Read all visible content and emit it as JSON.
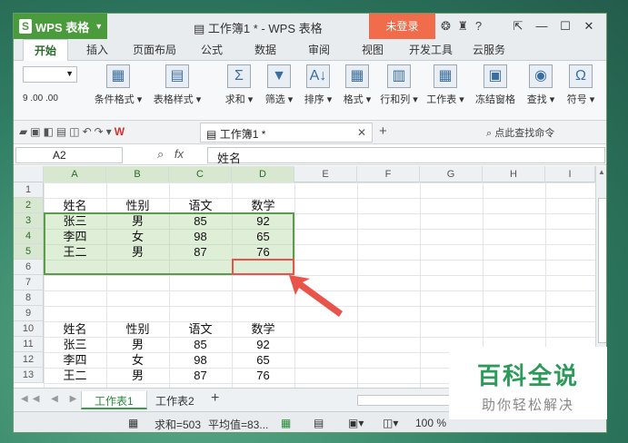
{
  "app": {
    "name": "WPS 表格",
    "logo_letter": "S",
    "title": "工作簿1 * - WPS 表格",
    "login_label": "未登录",
    "accent": "#4a9b3b"
  },
  "menu_tabs": [
    "开始",
    "插入",
    "页面布局",
    "公式",
    "数据",
    "审阅",
    "视图",
    "开发工具",
    "云服务"
  ],
  "ribbon": {
    "buttons": [
      {
        "label": "条件格式 ▾",
        "icon": "conditional-format-icon",
        "glyph": "▦"
      },
      {
        "label": "表格样式 ▾",
        "icon": "table-style-icon",
        "glyph": "▤"
      },
      {
        "label": "求和 ▾",
        "icon": "sum-icon",
        "glyph": "Σ"
      },
      {
        "label": "筛选 ▾",
        "icon": "filter-icon",
        "glyph": "▼"
      },
      {
        "label": "排序 ▾",
        "icon": "sort-icon",
        "glyph": "A↓"
      },
      {
        "label": "格式 ▾",
        "icon": "format-icon",
        "glyph": "▦"
      },
      {
        "label": "行和列 ▾",
        "icon": "rows-cols-icon",
        "glyph": "▥"
      },
      {
        "label": "工作表 ▾",
        "icon": "worksheet-icon",
        "glyph": "▦"
      },
      {
        "label": "冻结窗格",
        "icon": "freeze-panes-icon",
        "glyph": "▣"
      },
      {
        "label": "查找 ▾",
        "icon": "find-icon",
        "glyph": "◉"
      },
      {
        "label": "符号 ▾",
        "icon": "symbol-icon",
        "glyph": "Ω"
      }
    ],
    "numfmt": "9  .00 .00"
  },
  "doc_tab": "工作簿1 *",
  "quick_find": "点此查找命令",
  "namebox": "A2",
  "formula_value": "姓名",
  "columns": [
    "A",
    "B",
    "C",
    "D",
    "E",
    "F",
    "G",
    "H",
    "I"
  ],
  "rows": [
    "1",
    "2",
    "3",
    "4",
    "5",
    "6",
    "7",
    "8",
    "9",
    "10",
    "11",
    "12",
    "13"
  ],
  "table1": [
    [
      "姓名",
      "性别",
      "语文",
      "数学"
    ],
    [
      "张三",
      "男",
      "85",
      "92"
    ],
    [
      "李四",
      "女",
      "98",
      "65"
    ],
    [
      "王二",
      "男",
      "87",
      "76"
    ]
  ],
  "table2": [
    [
      "姓名",
      "性别",
      "语文",
      "数学"
    ],
    [
      "张三",
      "男",
      "85",
      "92"
    ],
    [
      "李四",
      "女",
      "98",
      "65"
    ],
    [
      "王二",
      "男",
      "87",
      "76"
    ]
  ],
  "sheets": [
    "工作表1",
    "工作表2"
  ],
  "status": {
    "sum": "求和=503",
    "avg": "平均值=83...",
    "zoom": "100 %"
  },
  "watermark": {
    "line1": "百科全说",
    "line2": "助你轻松解决"
  }
}
